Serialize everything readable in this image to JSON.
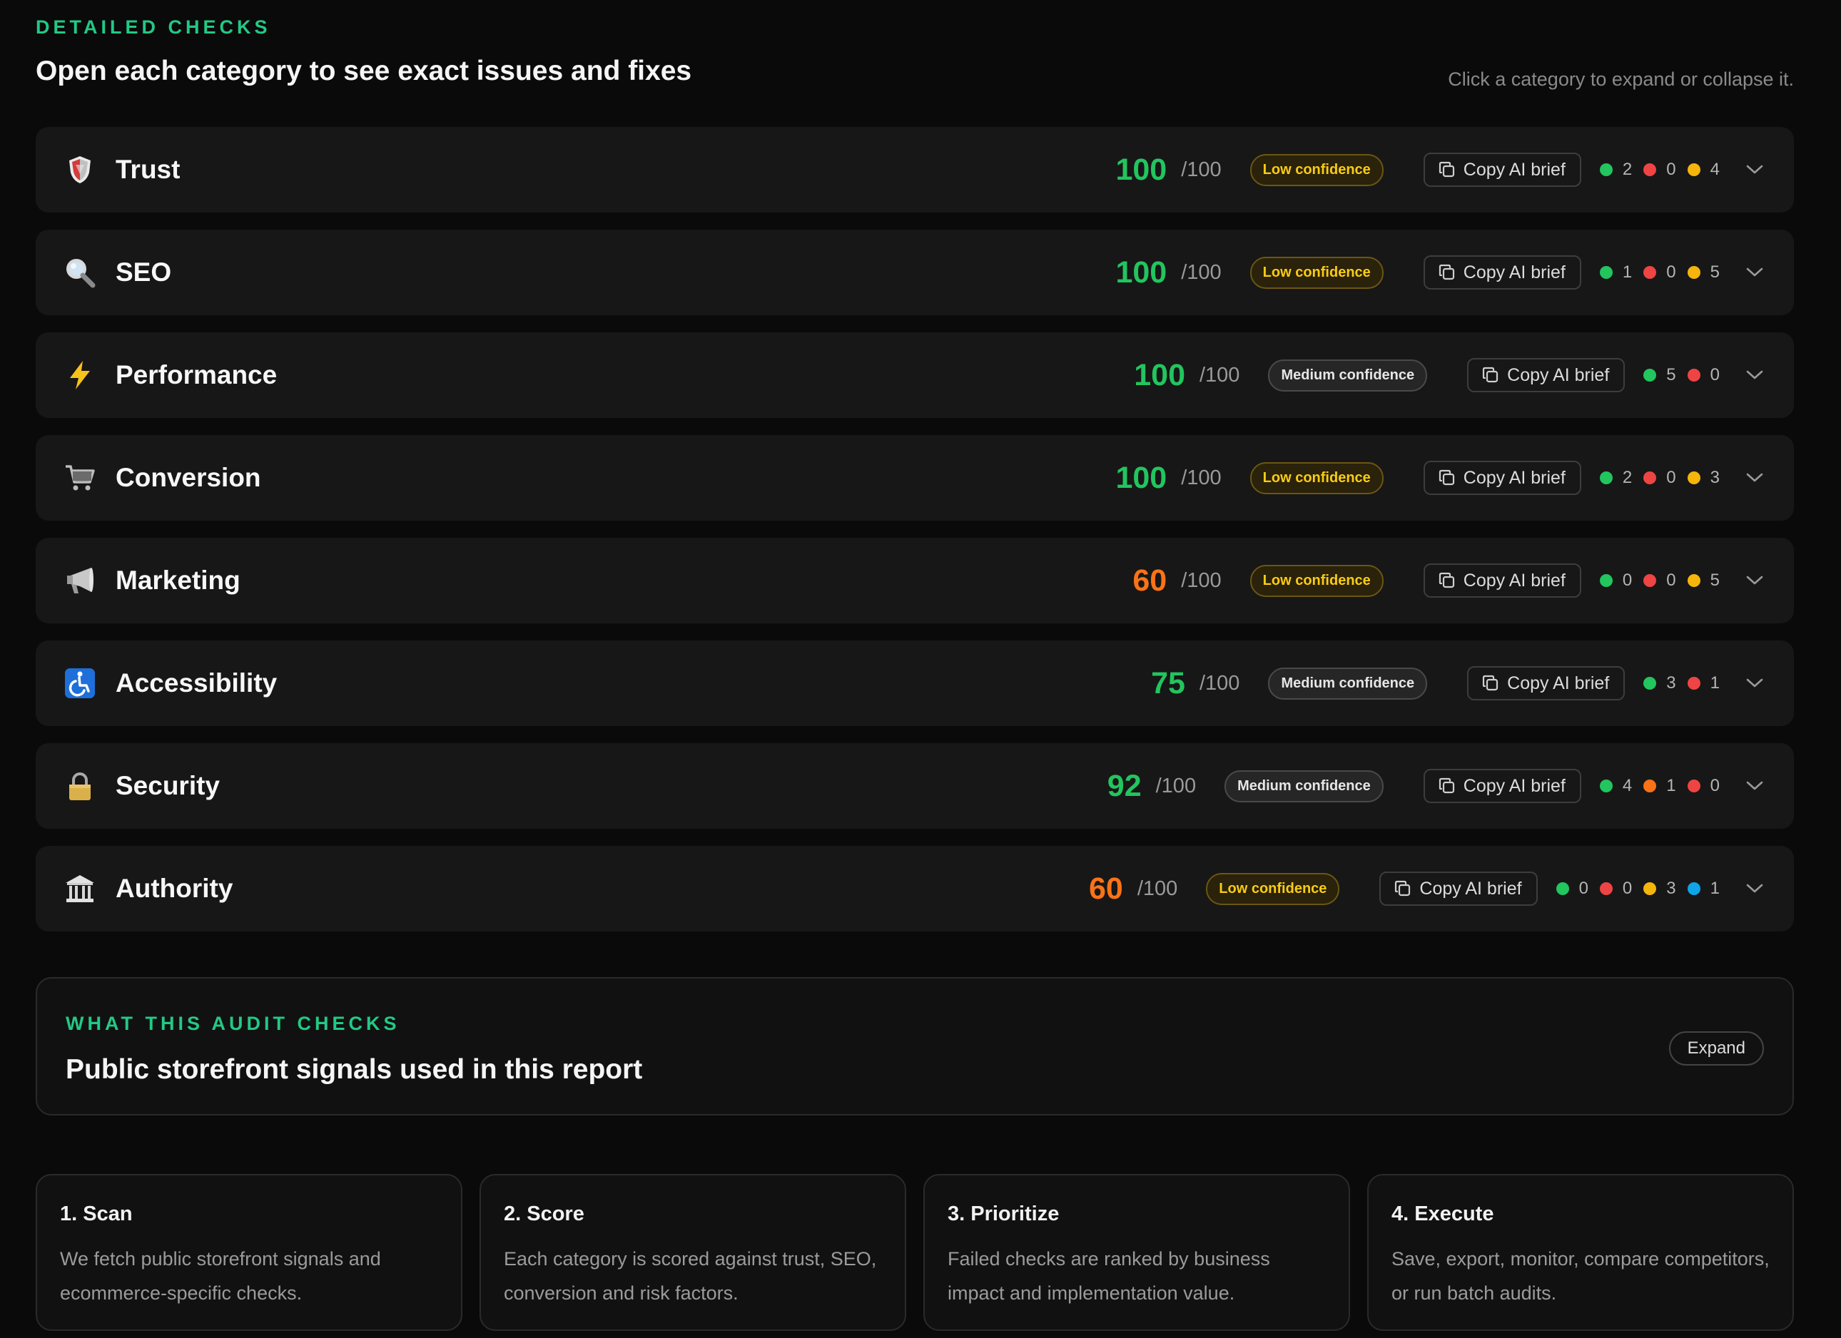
{
  "header": {
    "eyebrow": "DETAILED CHECKS",
    "title": "Open each category to see exact issues and fixes",
    "hint": "Click a category to expand or collapse it."
  },
  "categories": [
    {
      "name": "Trust",
      "icon": "shield-icon",
      "score": "100",
      "out_of": "/100",
      "confidence": "Low confidence",
      "confidence_level": "low",
      "copy_label": "Copy AI brief",
      "counts": [
        {
          "color": "green",
          "value": "2"
        },
        {
          "color": "red",
          "value": "0"
        },
        {
          "color": "yellow",
          "value": "4"
        }
      ]
    },
    {
      "name": "SEO",
      "icon": "magnifier-icon",
      "score": "100",
      "out_of": "/100",
      "confidence": "Low confidence",
      "confidence_level": "low",
      "copy_label": "Copy AI brief",
      "counts": [
        {
          "color": "green",
          "value": "1"
        },
        {
          "color": "red",
          "value": "0"
        },
        {
          "color": "yellow",
          "value": "5"
        }
      ]
    },
    {
      "name": "Performance",
      "icon": "lightning-icon",
      "score": "100",
      "out_of": "/100",
      "confidence": "Medium confidence",
      "confidence_level": "med",
      "copy_label": "Copy AI brief",
      "counts": [
        {
          "color": "green",
          "value": "5"
        },
        {
          "color": "red",
          "value": "0"
        }
      ]
    },
    {
      "name": "Conversion",
      "icon": "cart-icon",
      "score": "100",
      "out_of": "/100",
      "confidence": "Low confidence",
      "confidence_level": "low",
      "copy_label": "Copy AI brief",
      "counts": [
        {
          "color": "green",
          "value": "2"
        },
        {
          "color": "red",
          "value": "0"
        },
        {
          "color": "yellow",
          "value": "3"
        }
      ]
    },
    {
      "name": "Marketing",
      "icon": "megaphone-icon",
      "score": "60",
      "out_of": "/100",
      "confidence": "Low confidence",
      "confidence_level": "low",
      "copy_label": "Copy AI brief",
      "counts": [
        {
          "color": "green",
          "value": "0"
        },
        {
          "color": "red",
          "value": "0"
        },
        {
          "color": "yellow",
          "value": "5"
        }
      ]
    },
    {
      "name": "Accessibility",
      "icon": "wheelchair-icon",
      "score": "75",
      "out_of": "/100",
      "confidence": "Medium confidence",
      "confidence_level": "med",
      "copy_label": "Copy AI brief",
      "counts": [
        {
          "color": "green",
          "value": "3"
        },
        {
          "color": "red",
          "value": "1"
        }
      ]
    },
    {
      "name": "Security",
      "icon": "lock-icon",
      "score": "92",
      "out_of": "/100",
      "confidence": "Medium confidence",
      "confidence_level": "med",
      "copy_label": "Copy AI brief",
      "counts": [
        {
          "color": "green",
          "value": "4"
        },
        {
          "color": "orange",
          "value": "1"
        },
        {
          "color": "red",
          "value": "0"
        }
      ]
    },
    {
      "name": "Authority",
      "icon": "bank-icon",
      "score": "60",
      "out_of": "/100",
      "confidence": "Low confidence",
      "confidence_level": "low",
      "copy_label": "Copy AI brief",
      "counts": [
        {
          "color": "green",
          "value": "0"
        },
        {
          "color": "red",
          "value": "0"
        },
        {
          "color": "yellow",
          "value": "3"
        },
        {
          "color": "blue",
          "value": "1"
        }
      ]
    }
  ],
  "audit": {
    "eyebrow": "WHAT THIS AUDIT CHECKS",
    "title": "Public storefront signals used in this report",
    "expand_label": "Expand"
  },
  "steps": [
    {
      "title": "1. Scan",
      "text": "We fetch public storefront signals and ecommerce-specific checks."
    },
    {
      "title": "2. Score",
      "text": "Each category is scored against trust, SEO, conversion and risk factors."
    },
    {
      "title": "3. Prioritize",
      "text": "Failed checks are ranked by business impact and implementation value."
    },
    {
      "title": "4. Execute",
      "text": "Save, export, monitor, compare competitors, or run batch audits."
    }
  ],
  "colors": {
    "accent": "#22c985",
    "score_green": "#22c55e",
    "score_orange": "#f97316",
    "dot_green": "#22c55e",
    "dot_red": "#ef4444",
    "dot_yellow": "#f5b50a",
    "dot_orange": "#f97316",
    "dot_blue": "#0ea5e9"
  }
}
